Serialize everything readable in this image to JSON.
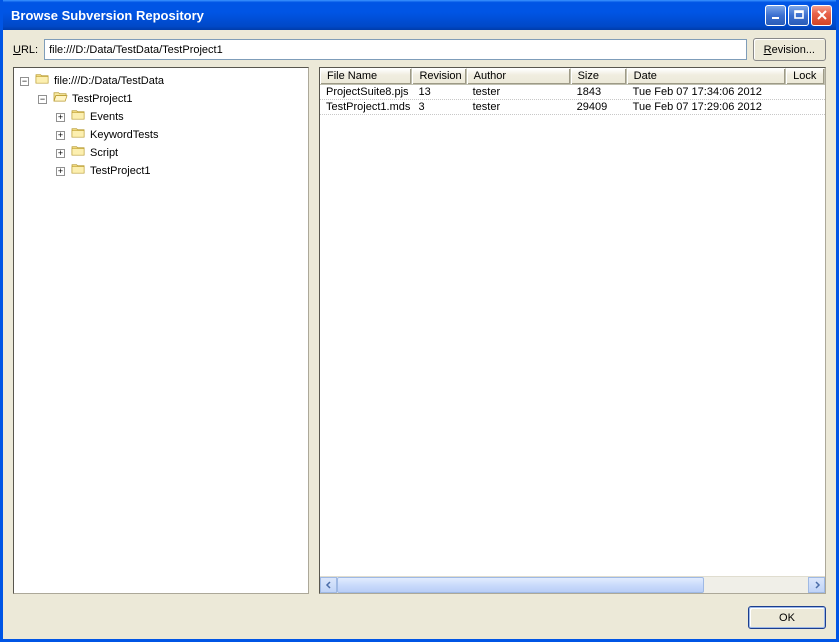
{
  "window": {
    "title": "Browse Subversion Repository"
  },
  "urlbar": {
    "label_prefix": "U",
    "label_rest": "RL:",
    "value": "file:///D:/Data/TestData/TestProject1",
    "revision_btn_prefix": "R",
    "revision_btn_rest": "evision..."
  },
  "tree": {
    "root": {
      "label": "file:///D:/Data/TestData",
      "expanded": true,
      "children": [
        {
          "label": "TestProject1",
          "expanded": true,
          "open": true,
          "children": [
            {
              "label": "Events",
              "expanded": false
            },
            {
              "label": "KeywordTests",
              "expanded": false
            },
            {
              "label": "Script",
              "expanded": false
            },
            {
              "label": "TestProject1",
              "expanded": false
            }
          ]
        }
      ]
    }
  },
  "list": {
    "columns": {
      "name": "File Name",
      "revision": "Revision",
      "author": "Author",
      "size": "Size",
      "date": "Date",
      "lock": "Lock"
    },
    "rows": [
      {
        "name": "ProjectSuite8.pjs",
        "revision": "13",
        "author": "tester",
        "size": "1843",
        "date": "Tue Feb 07 17:34:06 2012",
        "lock": ""
      },
      {
        "name": "TestProject1.mds",
        "revision": "3",
        "author": "tester",
        "size": "29409",
        "date": "Tue Feb 07 17:29:06 2012",
        "lock": ""
      }
    ]
  },
  "footer": {
    "ok": "OK"
  }
}
